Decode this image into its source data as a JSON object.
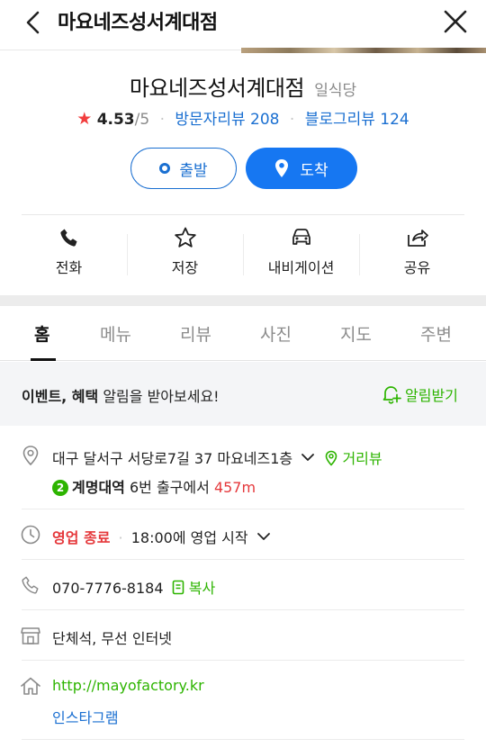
{
  "topbar": {
    "title": "마요네즈성서계대점"
  },
  "place": {
    "name": "마요네즈성서계대점",
    "category": "일식당",
    "rating": "4.53",
    "rating_max": "/5",
    "visitor_review_label": "방문자리뷰",
    "visitor_review_count": "208",
    "blog_review_label": "블로그리뷰",
    "blog_review_count": "124"
  },
  "route": {
    "start_label": "출발",
    "arrive_label": "도착"
  },
  "actions": [
    {
      "label": "전화",
      "icon": "phone-icon"
    },
    {
      "label": "저장",
      "icon": "star-outline-icon"
    },
    {
      "label": "내비게이션",
      "icon": "car-icon"
    },
    {
      "label": "공유",
      "icon": "share-icon"
    }
  ],
  "tabs": [
    "홈",
    "메뉴",
    "리뷰",
    "사진",
    "지도",
    "주변"
  ],
  "banner": {
    "text_bold": "이벤트, 혜택",
    "text_rest": " 알림을 받아보세요!",
    "button": "알림받기"
  },
  "info": {
    "address": "대구 달서구 서당로7길 37 마요네즈1층",
    "street_view": "거리뷰",
    "subway_line": "2",
    "station": "계명대역",
    "exit_text": " 6번 출구에서 ",
    "distance": "457m",
    "status": "영업 종료",
    "hours": "18:00에 영업 시작",
    "phone": "070-7776-8184",
    "copy": "복사",
    "amenities": "단체석, 무선 인터넷",
    "website": "http://mayofactory.kr",
    "instagram": "인스타그램"
  },
  "colors": {
    "accent_blue": "#1677f2",
    "link_blue": "#1a6fd1",
    "naver_green": "#2db400",
    "alert_red": "#e5383b",
    "star_red": "#f23d3d"
  }
}
